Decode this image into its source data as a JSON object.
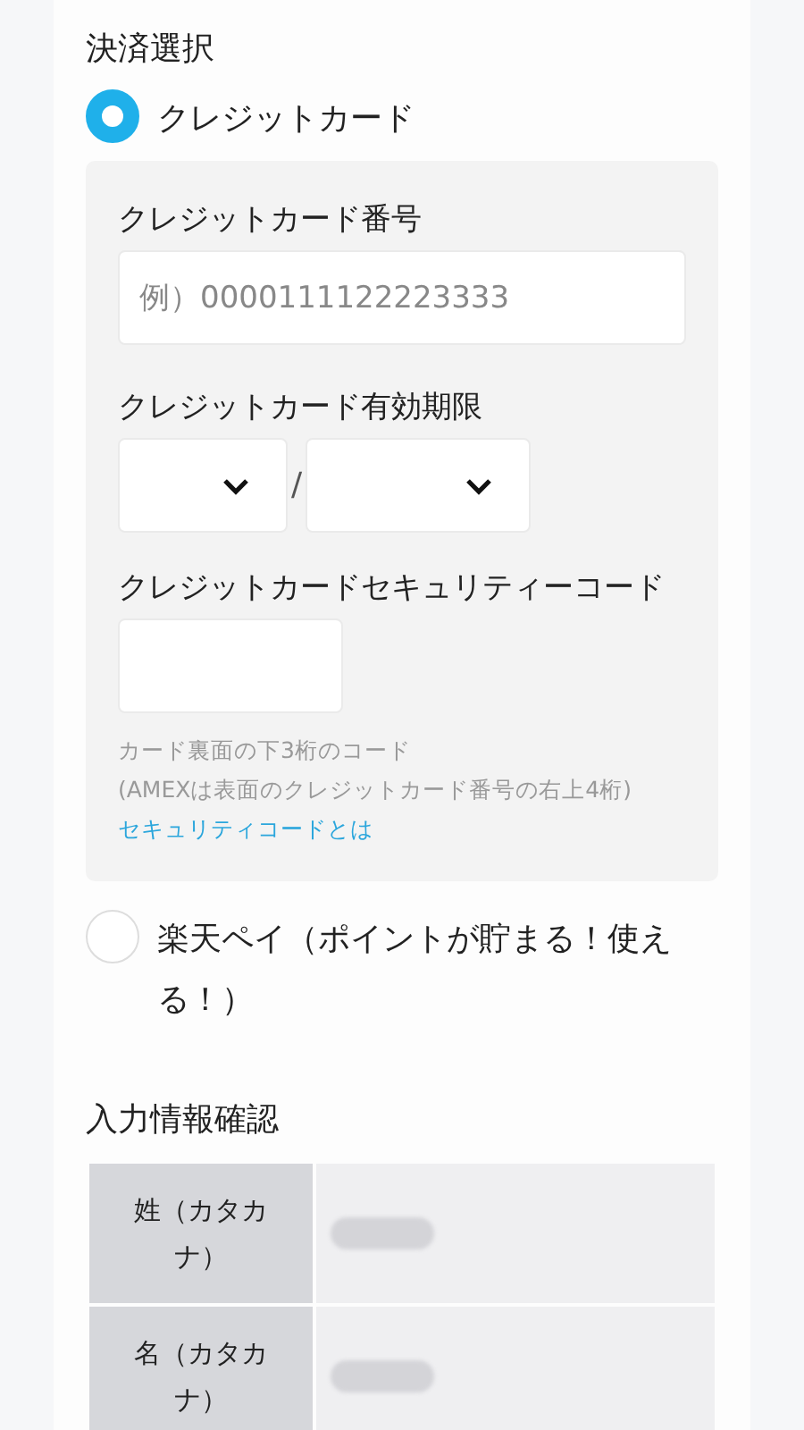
{
  "payment_section": {
    "title": "決済選択",
    "options": [
      {
        "label": "クレジットカード",
        "selected": true
      },
      {
        "label": "楽天ペイ（ポイントが貯まる！使える！）",
        "selected": false
      }
    ],
    "card_form": {
      "number_label": "クレジットカード番号",
      "number_placeholder": "例）0000111122223333",
      "expiry_label": "クレジットカード有効期限",
      "expiry_separator": "/",
      "cvc_label": "クレジットカードセキュリティーコード",
      "help_lines": [
        "カード裏面の下3桁のコード",
        "(AMEXは表面のクレジットカード番号の右上4桁)"
      ],
      "help_link": "セキュリティコードとは"
    }
  },
  "confirm_section": {
    "title": "入力情報確認",
    "rows": [
      {
        "label": "姓（カタカナ）"
      },
      {
        "label": "名（カタカナ）"
      }
    ]
  }
}
